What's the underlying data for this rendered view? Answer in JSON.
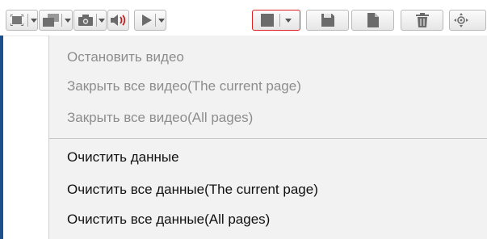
{
  "toolbar": {
    "buttons": [
      {
        "name": "fullscreen",
        "icon": "layout-grid-icon",
        "has_dropdown": true
      },
      {
        "name": "window-layout",
        "icon": "window-stack-icon",
        "has_dropdown": true
      },
      {
        "name": "snapshot",
        "icon": "camera-icon",
        "has_dropdown": true
      },
      {
        "name": "audio",
        "icon": "speaker-muted-icon",
        "has_dropdown": false
      },
      {
        "name": "play",
        "icon": "play-icon",
        "has_dropdown": true
      },
      {
        "name": "stop",
        "icon": "stop-icon",
        "has_dropdown": true,
        "active": true
      },
      {
        "name": "save",
        "icon": "save-icon",
        "has_dropdown": false
      },
      {
        "name": "file",
        "icon": "file-icon",
        "has_dropdown": false
      },
      {
        "name": "delete",
        "icon": "trash-icon",
        "has_dropdown": false
      },
      {
        "name": "ptz",
        "icon": "ptz-control-icon",
        "has_dropdown": false
      }
    ],
    "active_border_color": "#e02222",
    "speaker_accent_color": "#c02020"
  },
  "menu": {
    "items": [
      {
        "label": "Остановить видео",
        "enabled": false
      },
      {
        "label": "Закрыть все видео(The current page)",
        "enabled": false
      },
      {
        "label": "Закрыть все видео(All pages)",
        "enabled": false
      },
      {
        "label": "Очистить данные",
        "enabled": true
      },
      {
        "label": "Очистить все данные(The current page)",
        "enabled": true
      },
      {
        "label": "Очистить все данные(All pages)",
        "enabled": true
      }
    ]
  },
  "colors": {
    "menu_background": "#f2f2f2",
    "disabled_text": "#8d8d8d",
    "enabled_text": "#111111",
    "window_edge": "#1c4f8e"
  }
}
